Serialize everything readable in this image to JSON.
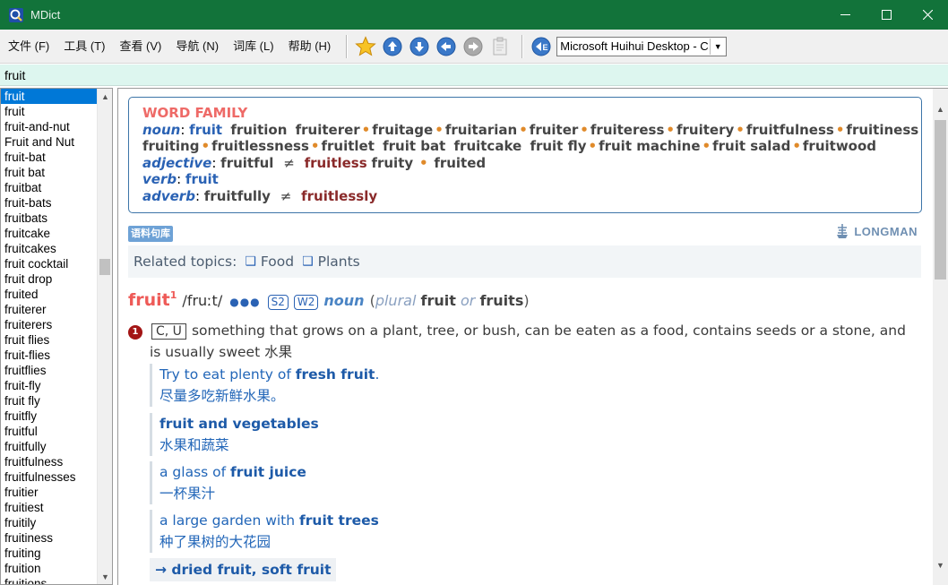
{
  "window": {
    "title": "MDict"
  },
  "menu": [
    "文件 (F)",
    "工具 (T)",
    "查看 (V)",
    "导航 (N)",
    "词库 (L)",
    "帮助 (H)"
  ],
  "toolbar": {
    "dictionary_selected": "Microsoft Huihui Desktop - C"
  },
  "search": {
    "value": "fruit"
  },
  "wordlist": {
    "selected_index": 0,
    "items": [
      "fruit",
      "fruit",
      "fruit-and-nut",
      "Fruit and Nut",
      "fruit-bat",
      "fruit bat",
      "fruitbat",
      "fruit-bats",
      "fruitbats",
      "fruitcake",
      "fruitcakes",
      "fruit cocktail",
      "fruit drop",
      "fruited",
      "fruiterer",
      "fruiterers",
      "fruit flies",
      "fruit-flies",
      "fruitflies",
      "fruit-fly",
      "fruit fly",
      "fruitfly",
      "fruitful",
      "fruitfully",
      "fruitfulness",
      "fruitfulnesses",
      "fruitier",
      "fruitiest",
      "fruitily",
      "fruitiness",
      "fruiting",
      "fruition",
      "fruitions"
    ]
  },
  "word_family": {
    "title": "WORD FAMILY",
    "noun_label": "noun",
    "noun_line1": [
      "fruit",
      "fruition",
      "fruiterer",
      "fruitage",
      "fruitarian",
      "fruiter",
      "fruiteress",
      "fruitery",
      "fruitfulness",
      "fruitiness"
    ],
    "noun_line2": [
      "fruiting",
      "fruitlessness",
      "fruitlet",
      "fruit bat",
      "fruitcake",
      "fruit fly",
      "fruit machine",
      "fruit salad",
      "fruitwood"
    ],
    "adjective_label": "adjective",
    "adjective": {
      "w1": "fruitful",
      "neq": "≠",
      "w2": "fruitless",
      "w3": "fruity",
      "w4": "fruited"
    },
    "verb_label": "verb",
    "verb": {
      "w1": "fruit"
    },
    "adverb_label": "adverb",
    "adverb": {
      "w1": "fruitfully",
      "neq": "≠",
      "w2": "fruitlessly"
    }
  },
  "corpus_badge": "语料句库",
  "publisher": "LONGMAN",
  "topics": {
    "label": "Related topics:",
    "items": [
      "Food",
      "Plants"
    ]
  },
  "entry": {
    "word": "fruit",
    "homograph": "1",
    "pronunciation": "/fruːt/",
    "frequency": "●●●",
    "tags": [
      "S2",
      "W2"
    ],
    "pos": "noun",
    "plural_open": "(",
    "plural_label": "plural",
    "plural_w1": "fruit",
    "plural_or": "or",
    "plural_w2": "fruits",
    "plural_close": ")"
  },
  "sense": {
    "number": "1",
    "grammar": "C, U",
    "def_line1": "something that grows on a plant, tree, or bush, can be eaten as a food, contains seeds or a stone, and",
    "def_line2": "is usually sweet 水果"
  },
  "examples": [
    {
      "pre": "Try to eat plenty of ",
      "bold": "fresh fruit",
      "post": ".",
      "zh": "尽量多吃新鲜水果。"
    },
    {
      "pre": "",
      "bold": "fruit and vegetables",
      "post": "",
      "zh": "水果和蔬菜"
    },
    {
      "pre": "a glass of ",
      "bold": "fruit juice",
      "post": "",
      "zh": "一杯果汁"
    },
    {
      "pre": "a large garden with ",
      "bold": "fruit trees",
      "post": "",
      "zh": "种了果树的大花园"
    }
  ],
  "crossref": {
    "arrow": "→",
    "w1": "dried fruit",
    "sep": ", ",
    "w2": "soft fruit"
  }
}
